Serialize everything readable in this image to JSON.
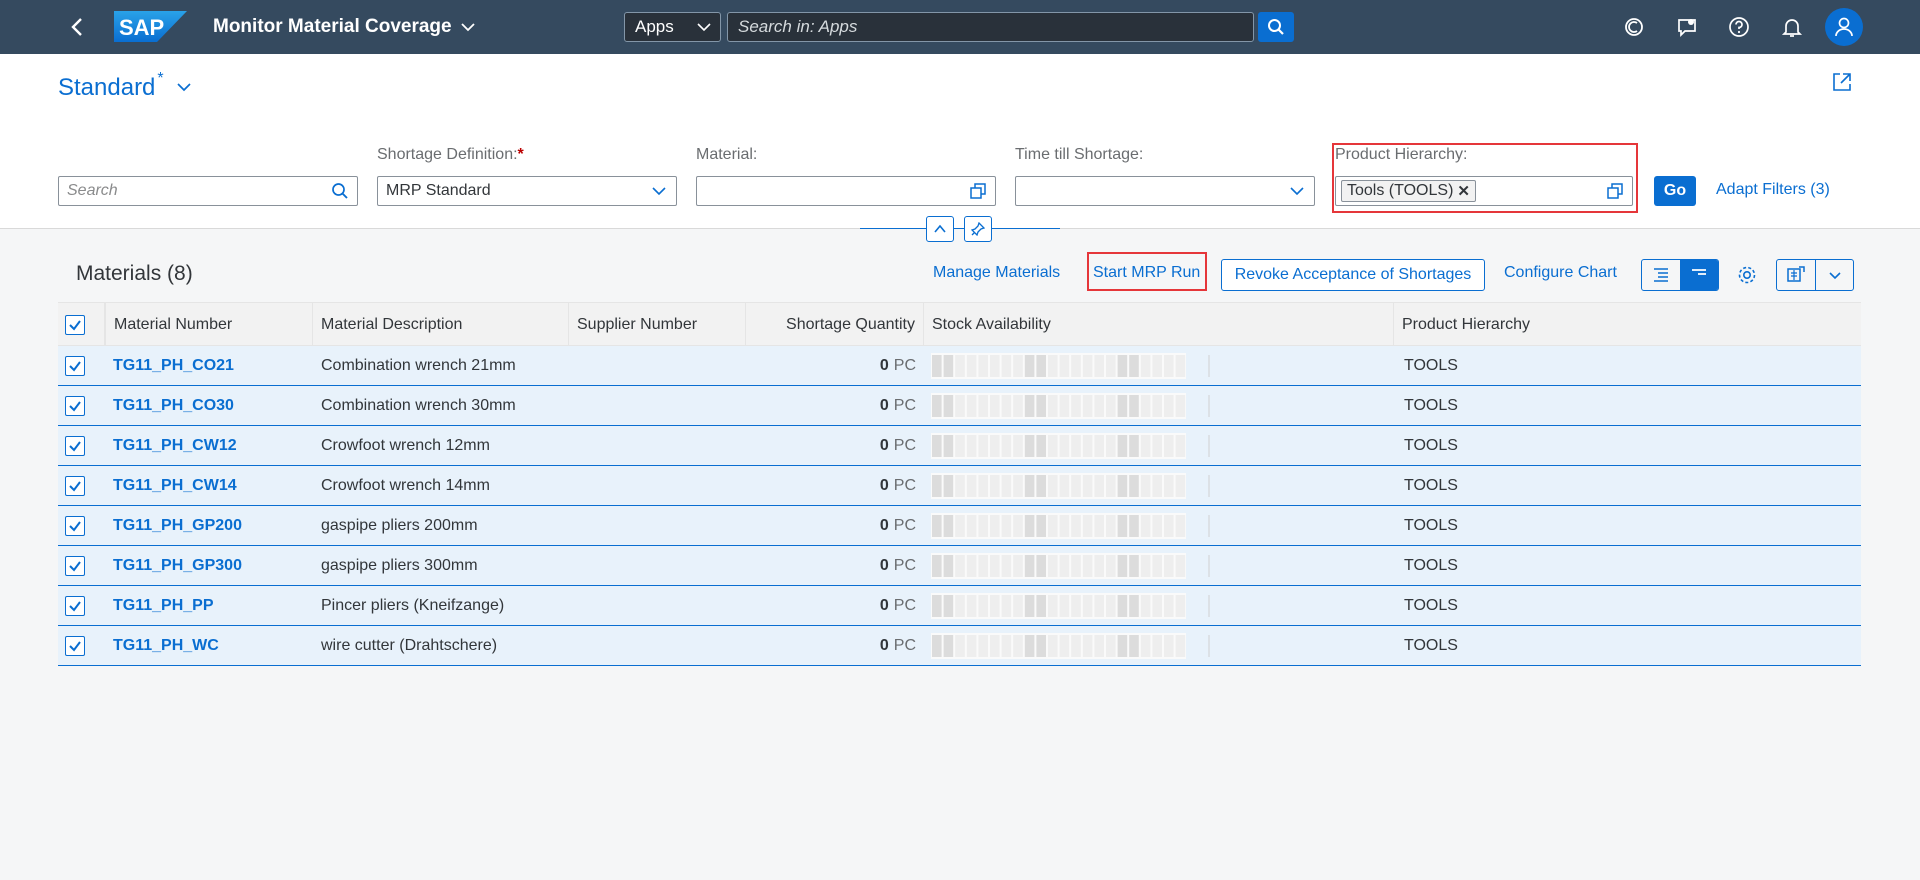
{
  "shell": {
    "logo_text": "SAP",
    "app_title": "Monitor Material Coverage",
    "apps_select": "Apps",
    "search_placeholder": "Search in: Apps"
  },
  "header": {
    "variant_name": "Standard",
    "variant_modified": "*"
  },
  "filters": {
    "search_placeholder": "Search",
    "shortage_definition": {
      "label": "Shortage Definition:",
      "required": "*",
      "value": "MRP Standard"
    },
    "material": {
      "label": "Material:",
      "value": ""
    },
    "time_till_shortage": {
      "label": "Time till Shortage:",
      "value": ""
    },
    "product_hierarchy": {
      "label": "Product Hierarchy:",
      "token": "Tools (TOOLS)"
    },
    "go_label": "Go",
    "adapt_filters_label": "Adapt Filters (3)"
  },
  "toolbar": {
    "title": "Materials (8)",
    "manage_materials": "Manage Materials",
    "start_mrp_run": "Start MRP Run",
    "revoke_acceptance": "Revoke Acceptance of Shortages",
    "configure_chart": "Configure Chart"
  },
  "table": {
    "columns": [
      "Material Number",
      "Material Description",
      "Supplier Number",
      "Shortage Quantity",
      "Stock Availability",
      "Product Hierarchy"
    ],
    "rows": [
      {
        "material": "TG11_PH_CO21",
        "description": "Combination wrench 21mm",
        "supplier": "",
        "qty": "0",
        "unit": "PC",
        "hierarchy": "TOOLS"
      },
      {
        "material": "TG11_PH_CO30",
        "description": "Combination wrench 30mm",
        "supplier": "",
        "qty": "0",
        "unit": "PC",
        "hierarchy": "TOOLS"
      },
      {
        "material": "TG11_PH_CW12",
        "description": "Crowfoot wrench 12mm",
        "supplier": "",
        "qty": "0",
        "unit": "PC",
        "hierarchy": "TOOLS"
      },
      {
        "material": "TG11_PH_CW14",
        "description": "Crowfoot wrench 14mm",
        "supplier": "",
        "qty": "0",
        "unit": "PC",
        "hierarchy": "TOOLS"
      },
      {
        "material": "TG11_PH_GP200",
        "description": "gaspipe pliers 200mm",
        "supplier": "",
        "qty": "0",
        "unit": "PC",
        "hierarchy": "TOOLS"
      },
      {
        "material": "TG11_PH_GP300",
        "description": "gaspipe pliers 300mm",
        "supplier": "",
        "qty": "0",
        "unit": "PC",
        "hierarchy": "TOOLS"
      },
      {
        "material": "TG11_PH_PP",
        "description": "Pincer pliers (Kneifzange)",
        "supplier": "",
        "qty": "0",
        "unit": "PC",
        "hierarchy": "TOOLS"
      },
      {
        "material": "TG11_PH_WC",
        "description": "wire cutter (Drahtschere)",
        "supplier": "",
        "qty": "0",
        "unit": "PC",
        "hierarchy": "TOOLS"
      }
    ]
  },
  "colors": {
    "shell": "#354a5f",
    "accent": "#0a6ed1",
    "row_selected": "#e8f2fb",
    "highlight": "#e5363a"
  }
}
